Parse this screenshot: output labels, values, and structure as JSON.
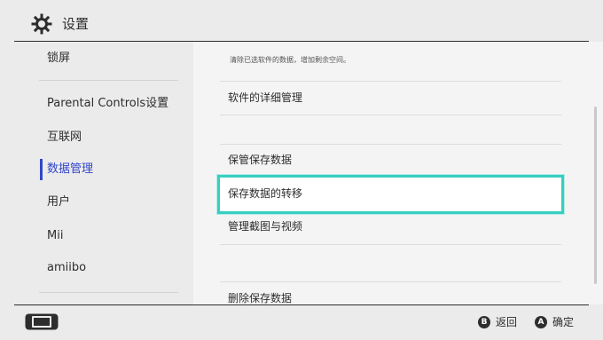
{
  "header": {
    "title": "设置"
  },
  "sidebar": {
    "items": [
      {
        "label": "锁屏"
      },
      {
        "label": "Parental Controls设置"
      },
      {
        "label": "互联网"
      },
      {
        "label": "数据管理",
        "active": true
      },
      {
        "label": "用户"
      },
      {
        "label": "Mii"
      },
      {
        "label": "amiibo"
      }
    ]
  },
  "main": {
    "hint": "清除已选软件的数据，增加剩余空间。",
    "rows": [
      {
        "label": "软件的详细管理"
      },
      {
        "label": "保管保存数据"
      },
      {
        "label": "保存数据的转移",
        "selected": true
      },
      {
        "label": "管理截图与视频"
      },
      {
        "label": "删除保存数据"
      }
    ]
  },
  "footer": {
    "back": {
      "key": "B",
      "label": "返回"
    },
    "ok": {
      "key": "A",
      "label": "确定"
    }
  },
  "colors": {
    "background": "#ebebeb",
    "panel": "#f4f4f4",
    "accent_active": "#3246c8",
    "selection_border": "#36cfc1",
    "text": "#2d2d2d"
  }
}
